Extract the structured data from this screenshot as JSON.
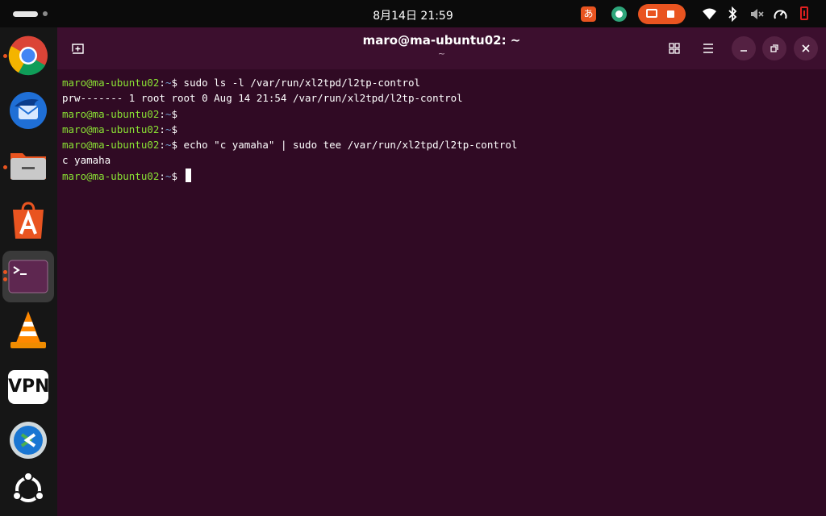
{
  "topbar": {
    "datetime": "8月14日  21:59",
    "ime_label": "あ"
  },
  "dock": {
    "apps": [
      {
        "name": "Google Chrome",
        "icon": "chrome-icon",
        "running": true
      },
      {
        "name": "Thunderbird",
        "icon": "thunderbird-icon",
        "running": false
      },
      {
        "name": "Files",
        "icon": "files-icon",
        "running": true
      },
      {
        "name": "App Center",
        "icon": "app-center-icon",
        "running": false
      },
      {
        "name": "Terminal",
        "icon": "terminal-icon",
        "running": true
      },
      {
        "name": "VLC",
        "icon": "vlc-icon",
        "running": false
      },
      {
        "name": "VPN",
        "icon": "vpn-icon",
        "label": "VPN",
        "running": false
      },
      {
        "name": "Remote Desktop",
        "icon": "remote-desktop-icon",
        "running": false
      },
      {
        "name": "Show Apps",
        "icon": "ubuntu-icon",
        "running": false
      }
    ]
  },
  "window": {
    "title": "maro@ma-ubuntu02: ~",
    "subtitle": "~"
  },
  "terminal": {
    "lines": [
      {
        "prompt": "maro@ma-ubuntu02",
        "sep": ":",
        "path": "~",
        "dollar": "$",
        "command": " sudo ls -l /var/run/xl2tpd/l2tp-control"
      },
      {
        "output": "prw------- 1 root root 0 Aug 14 21:54 /var/run/xl2tpd/l2tp-control"
      },
      {
        "prompt": "maro@ma-ubuntu02",
        "sep": ":",
        "path": "~",
        "dollar": "$",
        "command": ""
      },
      {
        "prompt": "maro@ma-ubuntu02",
        "sep": ":",
        "path": "~",
        "dollar": "$",
        "command": ""
      },
      {
        "prompt": "maro@ma-ubuntu02",
        "sep": ":",
        "path": "~",
        "dollar": "$",
        "command": " echo \"c yamaha\" | sudo tee /var/run/xl2tpd/l2tp-control"
      },
      {
        "output": "c yamaha"
      },
      {
        "prompt": "maro@ma-ubuntu02",
        "sep": ":",
        "path": "~",
        "dollar": "$",
        "command": " "
      }
    ]
  },
  "colors": {
    "terminal_bg": "#300a24",
    "titlebar_bg": "#3c0f2e",
    "prompt_green": "#8ae234",
    "accent_orange": "#e95420"
  }
}
